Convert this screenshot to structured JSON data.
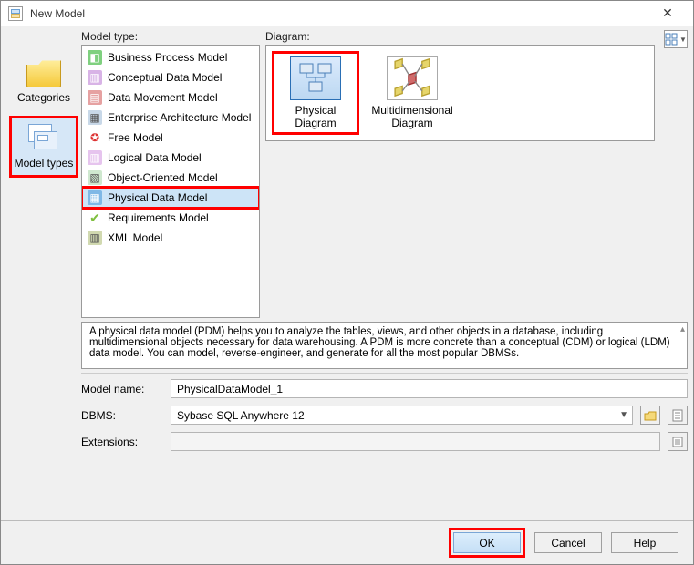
{
  "window": {
    "title": "New Model"
  },
  "leftnav": {
    "items": [
      {
        "label": "Categories"
      },
      {
        "label": "Model types"
      }
    ]
  },
  "labels": {
    "modeltype": "Model type:",
    "diagram": "Diagram:"
  },
  "modelTypes": [
    {
      "label": "Business Process Model"
    },
    {
      "label": "Conceptual Data Model"
    },
    {
      "label": "Data Movement Model"
    },
    {
      "label": "Enterprise Architecture Model"
    },
    {
      "label": "Free Model"
    },
    {
      "label": "Logical Data Model"
    },
    {
      "label": "Object-Oriented Model"
    },
    {
      "label": "Physical Data Model"
    },
    {
      "label": "Requirements Model"
    },
    {
      "label": "XML Model"
    }
  ],
  "diagrams": [
    {
      "label": "Physical Diagram"
    },
    {
      "label": "Multidimensional\nDiagram"
    }
  ],
  "description": "A physical data model (PDM) helps you to analyze the tables, views, and other objects in a database, including multidimensional objects necessary for data warehousing. A PDM is more concrete than a conceptual (CDM) or logical (LDM) data model. You can model, reverse-engineer, and generate for all the most popular DBMSs.",
  "form": {
    "modelname_label": "Model name:",
    "modelname_value": "PhysicalDataModel_1",
    "dbms_label": "DBMS:",
    "dbms_value": "Sybase SQL Anywhere 12",
    "extensions_label": "Extensions:"
  },
  "buttons": {
    "ok": "OK",
    "cancel": "Cancel",
    "help": "Help"
  }
}
